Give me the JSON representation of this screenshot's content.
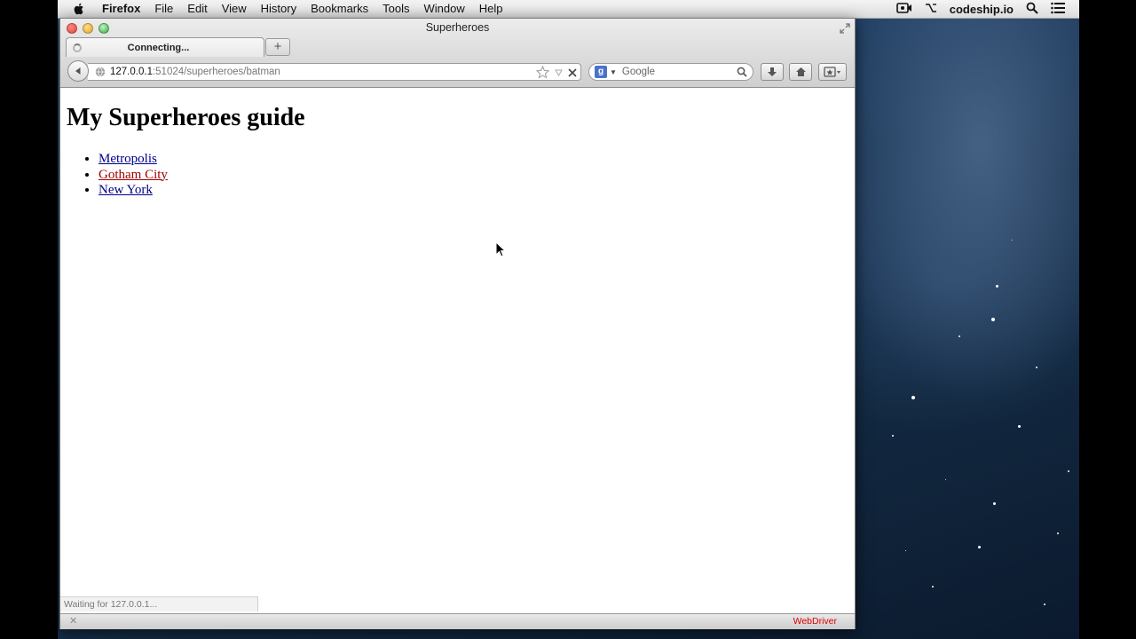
{
  "menubar": {
    "app_name": "Firefox",
    "items": [
      "File",
      "Edit",
      "View",
      "History",
      "Bookmarks",
      "Tools",
      "Window",
      "Help"
    ],
    "user": "codeship.io"
  },
  "window": {
    "title": "Superheroes",
    "tab_label": "Connecting...",
    "new_tab_symbol": "+",
    "url_host": "127.0.0.1",
    "url_path": ":51024/superheroes/batman",
    "search_placeholder": "Google",
    "search_badge": "g"
  },
  "page": {
    "heading": "My Superheroes guide",
    "links": [
      {
        "label": "Metropolis",
        "visited": false
      },
      {
        "label": "Gotham City",
        "visited": true
      },
      {
        "label": "New York",
        "visited": false
      }
    ]
  },
  "status": {
    "text": "Waiting for 127.0.0.1...",
    "addon_label": "WebDriver"
  },
  "colors": {
    "link": "#00008b",
    "visited_link": "#a00000",
    "webdriver_label": "#dd0000"
  }
}
